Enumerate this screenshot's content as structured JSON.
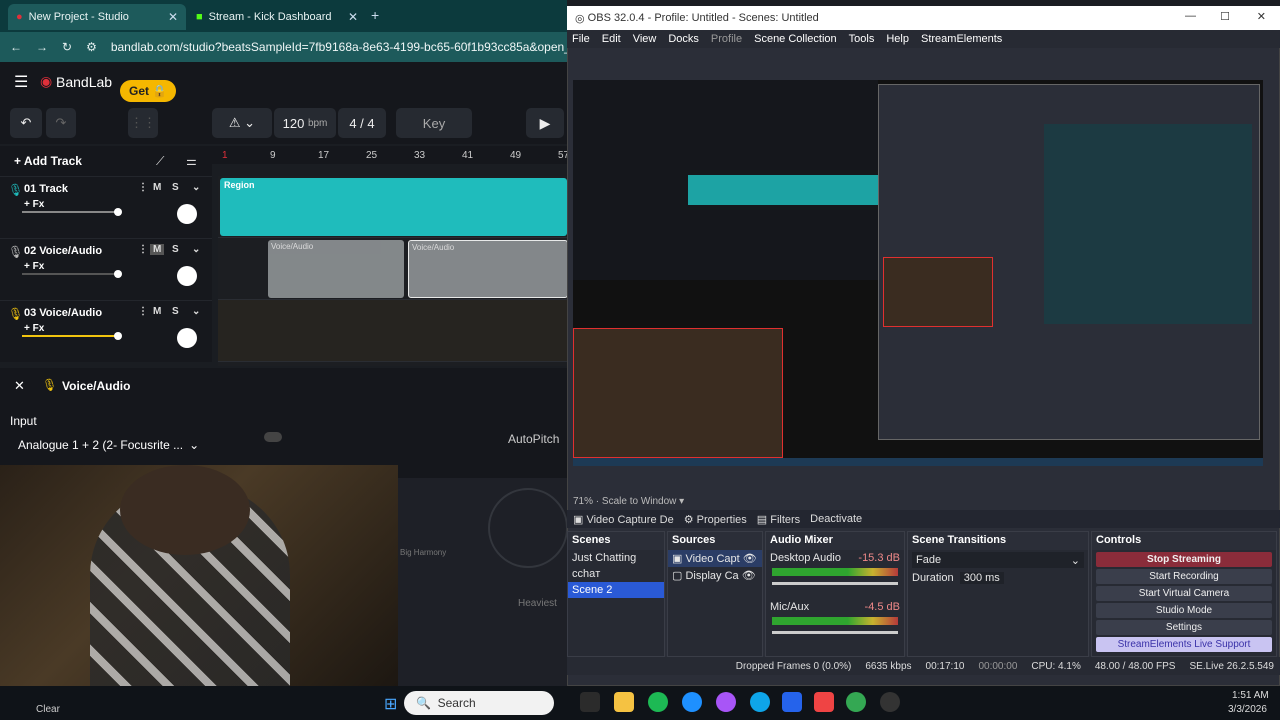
{
  "browser": {
    "tabs": [
      {
        "label": "New Project - Studio"
      },
      {
        "label": "Stream - Kick Dashboard"
      }
    ],
    "url": "bandlab.com/studio?beatsSampleId=7fb9168a-8e63-4199-bc65-60f1b93cc85a&open_attribution"
  },
  "bandlab": {
    "brand": "BandLab",
    "get_label": "Get",
    "bpm_value": "120",
    "bpm_unit": "bpm",
    "time_sig": "4 / 4",
    "key_label": "Key",
    "add_track": "Add Track",
    "ruler": [
      "1",
      "9",
      "17",
      "25",
      "33",
      "41",
      "49",
      "57"
    ],
    "tracks": [
      {
        "name": "01  Track",
        "fx": "+ Fx",
        "color": "#1fbcbc"
      },
      {
        "name": "02  Voice/Audio",
        "fx": "+ Fx",
        "color": "#b9bdc0"
      },
      {
        "name": "03  Voice/Audio",
        "fx": "+ Fx",
        "color": "#f1c40f"
      }
    ],
    "region_label": "Region",
    "clip_labels": [
      "Voice/Audio",
      "Voice/Audio"
    ],
    "panel_title": "Voice/Audio",
    "input_label": "Input",
    "input_value": "Analogue 1 + 2 (2- Focusrite ...",
    "autopitch": "AutoPitch",
    "big_harmony": "Big Harmony",
    "heaviest": "Heaviest"
  },
  "obs": {
    "title": "OBS 32.0.4 - Profile: Untitled - Scenes: Untitled",
    "menu": [
      "File",
      "Edit",
      "View",
      "Docks",
      "Profile",
      "Scene Collection",
      "Tools",
      "Help",
      "StreamElements"
    ],
    "zoom": "71%",
    "scale": "Scale to Window",
    "ctx_source": "Video Capture De",
    "ctx_properties": "Properties",
    "ctx_filters": "Filters",
    "ctx_deactivate": "Deactivate",
    "scenes_title": "Scenes",
    "scenes": [
      "Just Chatting",
      "cchaт",
      "Scene 2"
    ],
    "sources_title": "Sources",
    "sources": [
      "Video Capt",
      "Display Ca"
    ],
    "mixer_title": "Audio Mixer",
    "desktop_audio": "Desktop Audio",
    "desktop_db": "-15.3 dB",
    "mic_aux": "Mic/Aux",
    "mic_db": "-4.5 dB",
    "transitions_title": "Scene Transitions",
    "transition": "Fade",
    "duration_label": "Duration",
    "duration_value": "300 ms",
    "controls_title": "Controls",
    "controls": [
      "Stop Streaming",
      "Start Recording",
      "Start Virtual Camera",
      "Studio Mode",
      "Settings",
      "StreamElements Live Support"
    ],
    "status": {
      "dropped": "Dropped Frames 0 (0.0%)",
      "kbps": "6635 kbps",
      "live_time": "00:17:10",
      "rec_time": "00:00:00",
      "cpu": "CPU: 4.1%",
      "fps": "48.00 / 48.00 FPS",
      "se": "SE.Live 26.2.5.549"
    }
  },
  "taskbar": {
    "search": "Search",
    "time": "1:51 AM",
    "date": "3/3/2026",
    "weather": "Clear"
  },
  "colors": {
    "accent_teal": "#1fbcbc",
    "bandlab_red": "#e0303a",
    "obs_select": "#2a5ad6"
  }
}
